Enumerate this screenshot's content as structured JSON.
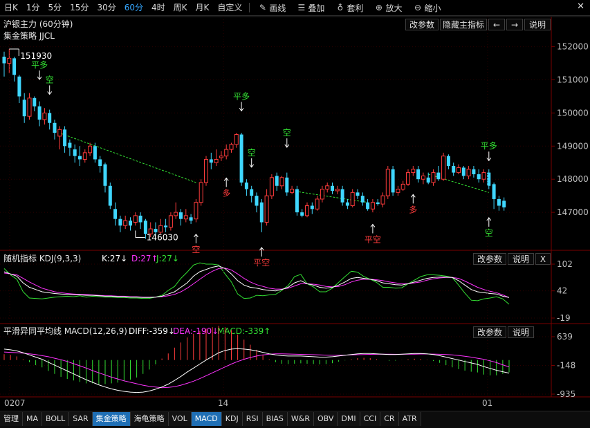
{
  "toolbar": {
    "periods": [
      "日K",
      "1分",
      "5分",
      "15分",
      "30分",
      "60分",
      "4时",
      "周K",
      "月K",
      "自定义"
    ],
    "active_period": "60分",
    "tools": [
      {
        "label": "画线",
        "icon": "pencil-icon",
        "glyph": "✎"
      },
      {
        "label": "叠加",
        "icon": "stack-icon",
        "glyph": "☰"
      },
      {
        "label": "套利",
        "icon": "moneybag-icon",
        "glyph": "♁"
      },
      {
        "label": "放大",
        "icon": "zoom-in-icon",
        "glyph": "⊕"
      },
      {
        "label": "缩小",
        "icon": "zoom-out-icon",
        "glyph": "⊖"
      }
    ],
    "close_glyph": "✕"
  },
  "main_panel": {
    "title": "沪银主力 (60分钟)",
    "subtitle": "集金策略 JJCL",
    "buttons": {
      "edit_params": "改参数",
      "hide_indicator": "隐藏主指标",
      "prev": "←",
      "next": "→",
      "help": "说明"
    },
    "y_ticks": [
      "152000",
      "151000",
      "150000",
      "149000",
      "148000",
      "147000"
    ]
  },
  "kdj_panel": {
    "title": "随机指标 KDJ(9,3,3)",
    "k": "K:27↓",
    "d": "D:27↑",
    "j": "J:27↓",
    "buttons": {
      "edit_params": "改参数",
      "help": "说明",
      "close": "X"
    },
    "y_ticks": [
      "102",
      "42",
      "-19"
    ]
  },
  "macd_panel": {
    "title": "平滑异同平均线 MACD(12,26,9)",
    "diff": "DIFF:-359↓",
    "dea": "DEA:-190↓",
    "macd": "MACD:-339↑",
    "buttons": {
      "edit_params": "改参数",
      "help": "说明"
    },
    "y_ticks": [
      "639",
      "-148",
      "-935"
    ]
  },
  "x_axis": {
    "labels": [
      "0207",
      "14",
      "01"
    ]
  },
  "bottom_tabs": [
    "管理",
    "MA",
    "BOLL",
    "SAR",
    "集金策略",
    "海龟策略",
    "VOL",
    "MACD",
    "KDJ",
    "RSI",
    "BIAS",
    "W&R",
    "OBV",
    "DMI",
    "CCI",
    "CR",
    "ATR"
  ],
  "active_tabs": [
    "集金策略",
    "MACD"
  ],
  "colors": {
    "up": "#ff3c3c",
    "down": "#3fd7ff",
    "signal_green": "#33e033",
    "signal_red": "#ff3c3c",
    "ma_white": "#ffffff",
    "ma_magenta": "#ff33ff",
    "grid": "#3a0000"
  },
  "chart_data": {
    "type": "candlestick",
    "title": "沪银主力 (60分钟)",
    "y_range": [
      146000,
      152200
    ],
    "high_label": "151930",
    "low_label": "146030",
    "candles": [
      [
        151700,
        151500,
        151850,
        151100
      ],
      [
        151500,
        151650,
        151930,
        151200
      ],
      [
        151650,
        151150,
        151700,
        150950
      ],
      [
        151100,
        150500,
        151150,
        150300
      ],
      [
        150400,
        149900,
        150600,
        149700
      ],
      [
        149900,
        150450,
        150600,
        149800
      ],
      [
        150450,
        150200,
        150500,
        150050
      ],
      [
        150200,
        149800,
        150350,
        149600
      ],
      [
        149800,
        150000,
        150150,
        149650
      ],
      [
        150000,
        149700,
        150100,
        149500
      ],
      [
        149700,
        149400,
        149800,
        149200
      ],
      [
        149300,
        149500,
        149600,
        148900
      ],
      [
        149500,
        149000,
        149600,
        148800
      ],
      [
        149100,
        148950,
        149200,
        148700
      ],
      [
        148900,
        148700,
        149050,
        148500
      ],
      [
        148700,
        148600,
        149000,
        148400
      ],
      [
        148600,
        148800,
        148900,
        148500
      ],
      [
        148800,
        149000,
        149100,
        148700
      ],
      [
        149000,
        148600,
        149100,
        148500
      ],
      [
        148600,
        148400,
        148700,
        148200
      ],
      [
        148450,
        147800,
        148500,
        147600
      ],
      [
        147800,
        147200,
        147900,
        147100
      ],
      [
        147100,
        146800,
        147300,
        146600
      ],
      [
        146800,
        146600,
        146900,
        146400
      ],
      [
        146600,
        146750,
        146900,
        146500
      ],
      [
        146750,
        146600,
        146850,
        146450
      ],
      [
        146700,
        146900,
        147000,
        146600
      ],
      [
        146900,
        146700,
        147000,
        146500
      ],
      [
        146750,
        146350,
        146800,
        146200
      ],
      [
        146350,
        146500,
        146700,
        146250
      ],
      [
        146500,
        146400,
        146700,
        146300
      ],
      [
        146400,
        146600,
        146800,
        146350
      ],
      [
        146600,
        146550,
        146800,
        146400
      ],
      [
        146550,
        146900,
        147000,
        146450
      ],
      [
        146900,
        147000,
        147300,
        146800
      ],
      [
        147000,
        146800,
        147100,
        146600
      ],
      [
        146800,
        146900,
        147100,
        146700
      ],
      [
        146850,
        146750,
        146950,
        146650
      ],
      [
        146800,
        147300,
        147400,
        146700
      ],
      [
        147300,
        147900,
        148000,
        147200
      ],
      [
        147900,
        148600,
        148700,
        147800
      ],
      [
        148600,
        148500,
        148800,
        148300
      ],
      [
        148500,
        148600,
        148900,
        148400
      ],
      [
        148650,
        148700,
        148850,
        148550
      ],
      [
        148700,
        148900,
        149050,
        148600
      ],
      [
        148900,
        149050,
        149100,
        148800
      ],
      [
        149050,
        149350,
        149400,
        148950
      ],
      [
        149350,
        147900,
        149400,
        147800
      ],
      [
        147900,
        147700,
        148000,
        147500
      ],
      [
        147700,
        147500,
        147800,
        147300
      ],
      [
        147500,
        147200,
        147600,
        147000
      ],
      [
        147300,
        146700,
        147400,
        146400
      ],
      [
        146700,
        147500,
        147700,
        146600
      ],
      [
        147500,
        148050,
        148150,
        147400
      ],
      [
        148100,
        147800,
        148200,
        147650
      ],
      [
        147800,
        148050,
        148100,
        147700
      ],
      [
        148050,
        147600,
        148200,
        147500
      ],
      [
        147600,
        147700,
        147800,
        147550
      ],
      [
        147700,
        147000,
        147800,
        146900
      ],
      [
        147000,
        146900,
        147100,
        146850
      ],
      [
        146900,
        147200,
        147300,
        146850
      ],
      [
        147200,
        147100,
        147300,
        146950
      ],
      [
        147100,
        147400,
        147500,
        147050
      ],
      [
        147400,
        147700,
        147800,
        147300
      ],
      [
        147700,
        147800,
        147900,
        147600
      ],
      [
        147800,
        147650,
        147900,
        147550
      ],
      [
        147650,
        147700,
        147800,
        147550
      ],
      [
        147700,
        147300,
        147800,
        147200
      ],
      [
        147300,
        147200,
        147400,
        147100
      ],
      [
        147200,
        147600,
        147700,
        147150
      ],
      [
        147600,
        147500,
        147700,
        147400
      ],
      [
        147500,
        147300,
        147600,
        147200
      ],
      [
        147300,
        147100,
        147400,
        147050
      ],
      [
        147100,
        147300,
        147400,
        147000
      ],
      [
        147300,
        147250,
        147400,
        147200
      ],
      [
        147250,
        147500,
        147600,
        147150
      ],
      [
        147500,
        148300,
        148400,
        147400
      ],
      [
        148300,
        147600,
        148400,
        147500
      ],
      [
        147600,
        147700,
        147800,
        147500
      ],
      [
        147700,
        147850,
        147950,
        147650
      ],
      [
        147850,
        148200,
        148300,
        147800
      ],
      [
        148200,
        148300,
        148400,
        148100
      ],
      [
        148300,
        148000,
        148400,
        147900
      ],
      [
        148000,
        148100,
        148200,
        147850
      ],
      [
        148050,
        147900,
        148200,
        147850
      ],
      [
        147900,
        148200,
        148300,
        147800
      ],
      [
        148200,
        148000,
        148400,
        147950
      ],
      [
        148000,
        148700,
        148800,
        147950
      ],
      [
        148700,
        148400,
        148750,
        148300
      ],
      [
        148400,
        148200,
        148500,
        148100
      ],
      [
        148200,
        148350,
        148450,
        148150
      ],
      [
        148350,
        148100,
        148400,
        148000
      ],
      [
        148100,
        148300,
        148400,
        148000
      ],
      [
        148300,
        148150,
        148400,
        148050
      ],
      [
        148150,
        148000,
        148300,
        147900
      ],
      [
        148000,
        148200,
        148300,
        147900
      ],
      [
        148200,
        147800,
        148300,
        147700
      ],
      [
        147850,
        147400,
        147900,
        147100
      ],
      [
        147400,
        147200,
        147500,
        147050
      ],
      [
        147350,
        147150,
        147450,
        147050
      ]
    ],
    "signals": [
      {
        "index": 7,
        "text": "平多",
        "dir": "down",
        "color": "green",
        "price": 150950
      },
      {
        "index": 9,
        "text": "空",
        "dir": "down",
        "color": "green",
        "price": 150500
      },
      {
        "index": 38,
        "text": "空",
        "dir": "up",
        "color": "red",
        "price": 146400
      },
      {
        "index": 44,
        "text": "多",
        "dir": "up",
        "color": "red",
        "price": 148100
      },
      {
        "index": 47,
        "text": "平多",
        "dir": "down",
        "color": "green",
        "price": 150000
      },
      {
        "index": 49,
        "text": "空",
        "dir": "down",
        "color": "green",
        "price": 148300
      },
      {
        "index": 51,
        "text": "平空",
        "dir": "up",
        "color": "red",
        "price": 146000
      },
      {
        "index": 56,
        "text": "空",
        "dir": "down",
        "color": "green",
        "price": 148900
      },
      {
        "index": 73,
        "text": "平空",
        "dir": "up",
        "color": "red",
        "price": 146700
      },
      {
        "index": 81,
        "text": "多",
        "dir": "up",
        "color": "red",
        "price": 147600
      },
      {
        "index": 96,
        "text": "平多",
        "dir": "down",
        "color": "green",
        "price": 148500
      },
      {
        "index": 96,
        "text": "空",
        "dir": "up",
        "color": "green",
        "price": 146900
      }
    ],
    "trend_lines": [
      {
        "from": [
          10,
          149450
        ],
        "to": [
          38,
          147900
        ]
      },
      {
        "from": [
          57,
          147650
        ],
        "to": [
          72,
          147300
        ]
      },
      {
        "from": [
          84,
          148150
        ],
        "to": [
          96,
          147600
        ]
      }
    ]
  },
  "kdj_data": {
    "range": [
      -19,
      102
    ],
    "K": [
      85,
      80,
      75,
      60,
      50,
      45,
      40,
      38,
      36,
      35,
      34,
      33,
      33,
      32,
      32,
      31,
      30,
      30,
      29,
      29,
      28,
      28,
      27,
      27,
      28,
      30,
      35,
      40,
      50,
      60,
      75,
      85,
      90,
      95,
      98,
      92,
      80,
      65,
      55,
      50,
      48,
      45,
      43,
      42,
      45,
      50,
      60,
      65,
      58,
      55,
      50,
      48,
      50,
      55,
      62,
      70,
      72,
      70,
      68,
      65,
      60,
      58,
      56,
      55,
      58,
      62,
      66,
      70,
      72,
      73,
      73,
      72,
      65,
      55,
      45,
      40,
      38,
      36,
      35,
      30,
      27
    ],
    "D": [
      82,
      80,
      78,
      70,
      62,
      55,
      48,
      44,
      40,
      38,
      36,
      35,
      34,
      34,
      33,
      32,
      31,
      31,
      30,
      30,
      29,
      29,
      28,
      28,
      28,
      29,
      31,
      34,
      40,
      48,
      58,
      68,
      78,
      86,
      92,
      93,
      89,
      80,
      70,
      62,
      56,
      52,
      48,
      46,
      46,
      48,
      53,
      58,
      58,
      57,
      55,
      52,
      51,
      52,
      56,
      62,
      66,
      68,
      68,
      67,
      65,
      62,
      60,
      58,
      58,
      60,
      62,
      66,
      69,
      71,
      72,
      72,
      70,
      64,
      57,
      50,
      45,
      41,
      38,
      33,
      27
    ],
    "J": [
      92,
      78,
      68,
      40,
      26,
      25,
      24,
      26,
      28,
      29,
      30,
      29,
      31,
      28,
      30,
      29,
      28,
      28,
      27,
      27,
      26,
      26,
      25,
      25,
      28,
      32,
      43,
      52,
      70,
      84,
      100,
      105,
      102,
      102,
      100,
      80,
      62,
      35,
      25,
      26,
      32,
      31,
      33,
      34,
      43,
      54,
      74,
      79,
      58,
      51,
      40,
      40,
      48,
      61,
      74,
      86,
      84,
      74,
      68,
      61,
      50,
      50,
      48,
      49,
      58,
      66,
      74,
      78,
      78,
      77,
      75,
      72,
      55,
      37,
      21,
      20,
      24,
      26,
      29,
      24,
      12
    ]
  },
  "macd_data": {
    "range": [
      -935,
      639
    ],
    "DIFF": [
      300,
      280,
      250,
      200,
      140,
      80,
      20,
      -60,
      -140,
      -220,
      -300,
      -380,
      -460,
      -540,
      -610,
      -680,
      -740,
      -790,
      -830,
      -860,
      -880,
      -890,
      -880,
      -850,
      -800,
      -740,
      -660,
      -560,
      -450,
      -330,
      -220,
      -110,
      0,
      100,
      200,
      260,
      300,
      310,
      300,
      280,
      250,
      210,
      170,
      140,
      120,
      110,
      110,
      110,
      100,
      90,
      80,
      80,
      90,
      110,
      130,
      150,
      170,
      180,
      180,
      170,
      160,
      150,
      150,
      160,
      170,
      180,
      180,
      170,
      150,
      120,
      80,
      40,
      0,
      -40,
      -80,
      -120,
      -180,
      -230,
      -280,
      -320,
      -359
    ],
    "DEA": [
      220,
      210,
      200,
      190,
      170,
      150,
      120,
      90,
      50,
      10,
      -40,
      -100,
      -160,
      -220,
      -290,
      -350,
      -410,
      -470,
      -520,
      -570,
      -610,
      -650,
      -690,
      -720,
      -740,
      -760,
      -750,
      -730,
      -690,
      -640,
      -580,
      -510,
      -430,
      -350,
      -270,
      -190,
      -110,
      -40,
      20,
      70,
      110,
      140,
      160,
      170,
      170,
      165,
      160,
      155,
      150,
      145,
      140,
      135,
      133,
      133,
      135,
      140,
      145,
      150,
      155,
      158,
      160,
      160,
      158,
      158,
      160,
      162,
      165,
      165,
      163,
      158,
      150,
      140,
      125,
      105,
      80,
      50,
      20,
      -20,
      -70,
      -130,
      -190
    ]
  }
}
